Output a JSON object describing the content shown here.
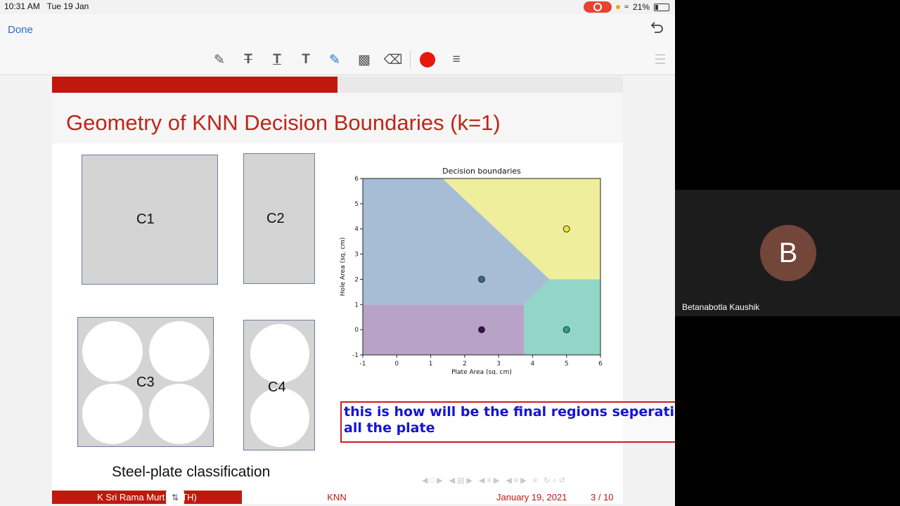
{
  "status_bar": {
    "time": "10:31 AM",
    "date": "Tue 19 Jan",
    "battery": "21%"
  },
  "nav": {
    "done_label": "Done"
  },
  "toolbar": {
    "tools": [
      "pen-icon",
      "strikethrough-text-icon",
      "underline-text-icon",
      "text-icon",
      "highlighter-icon",
      "comment-icon",
      "eraser-icon",
      "color-swatch",
      "line-weight-icon"
    ],
    "active_tool": "highlighter-icon",
    "ink_color": "#e8180c",
    "outline_icon": "list-icon"
  },
  "slide": {
    "progress_fraction": 0.5,
    "title": "Geometry of KNN Decision Boundaries (k=1)",
    "plates": [
      {
        "label": "C1"
      },
      {
        "label": "C2"
      },
      {
        "label": "C3"
      },
      {
        "label": "C4"
      }
    ],
    "caption": "Steel-plate classification",
    "footer": {
      "author": "K Sri Rama Murt",
      "author_suffix": "TH)",
      "topic": "KNN",
      "date": "January 19, 2021",
      "page": "3 / 10"
    },
    "brand_color": "#c0180c"
  },
  "chart_data": {
    "type": "scatter",
    "title": "Decision boundaries",
    "xlabel": "Plate Area (sq. cm)",
    "ylabel": "Hole Area (sq. cm)",
    "xlim": [
      -1,
      6
    ],
    "ylim": [
      -1,
      6
    ],
    "xticks": [
      -1,
      0,
      1,
      2,
      3,
      4,
      5,
      6
    ],
    "yticks": [
      -1,
      0,
      1,
      2,
      3,
      4,
      5,
      6
    ],
    "points": [
      {
        "x": 2.5,
        "y": 0,
        "color": "#3b0f4f"
      },
      {
        "x": 2.5,
        "y": 2,
        "color": "#3b6590"
      },
      {
        "x": 5,
        "y": 0,
        "color": "#26a08a"
      },
      {
        "x": 5,
        "y": 4,
        "color": "#f2e330"
      }
    ],
    "regions": [
      {
        "color": "#b8a3c6",
        "polygon": [
          [
            -1,
            -1
          ],
          [
            3.75,
            -1
          ],
          [
            3.75,
            1
          ],
          [
            -1,
            1
          ]
        ]
      },
      {
        "color": "#a6bdd5",
        "polygon": [
          [
            -1,
            1
          ],
          [
            3.75,
            1
          ],
          [
            4.5,
            2
          ],
          [
            1.35,
            6
          ],
          [
            -1,
            6
          ]
        ]
      },
      {
        "color": "#92d5c9",
        "polygon": [
          [
            3.75,
            -1
          ],
          [
            6,
            -1
          ],
          [
            6,
            2
          ],
          [
            4.5,
            2
          ],
          [
            3.75,
            1
          ]
        ]
      },
      {
        "color": "#eeee9c",
        "polygon": [
          [
            1.35,
            6
          ],
          [
            6,
            6
          ],
          [
            6,
            2
          ],
          [
            4.5,
            2
          ]
        ]
      }
    ],
    "grid": false
  },
  "annotation": {
    "text": "this is how will be the final regions seperation of all the plate"
  },
  "participant": {
    "initial": "B",
    "name": "Betanabotla Kaushik"
  },
  "handle_icon": "drag-handle-icon"
}
